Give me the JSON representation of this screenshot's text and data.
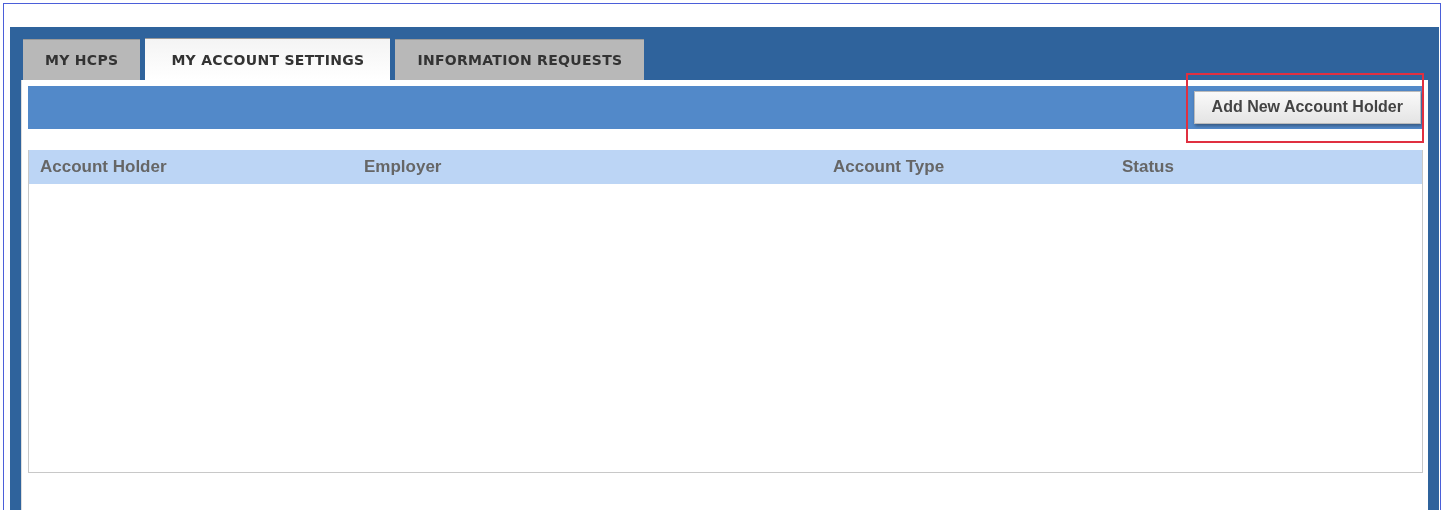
{
  "tabs": [
    {
      "label": "MY HCPS",
      "selected": false
    },
    {
      "label": "MY ACCOUNT SETTINGS",
      "selected": true
    },
    {
      "label": "INFORMATION REQUESTS",
      "selected": false
    }
  ],
  "toolbar": {
    "button": {
      "label": "Add New Account Holder",
      "highlighted": true
    }
  },
  "table": {
    "columns": [
      "Account Holder",
      "Employer",
      "Account Type",
      "Status"
    ]
  }
}
